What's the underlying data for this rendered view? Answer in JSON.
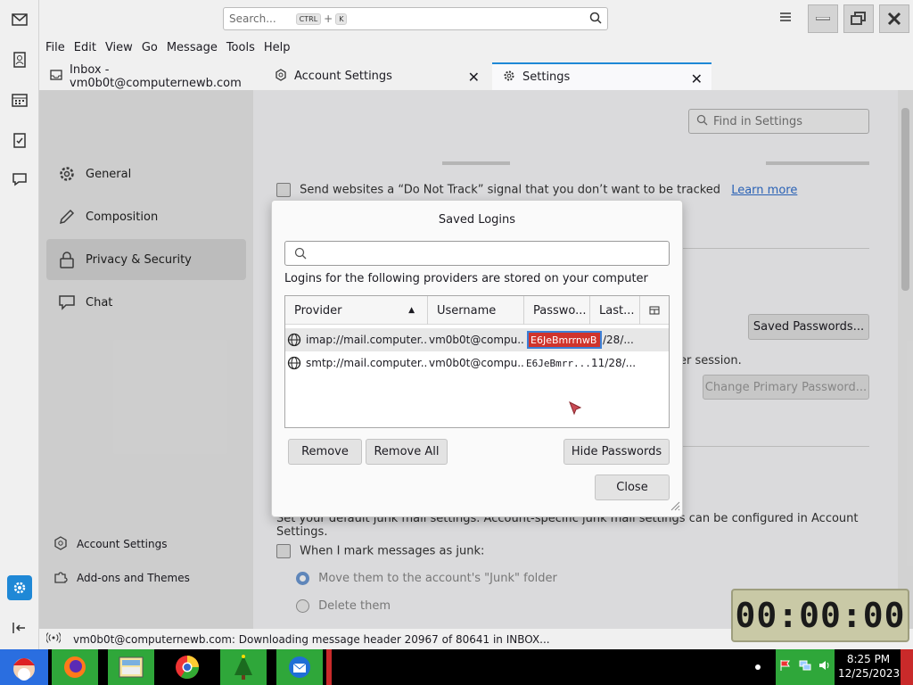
{
  "window": {
    "search_placeholder": "Search...",
    "kbd_ctrl": "CTRL",
    "kbd_plus": "+",
    "kbd_k": "K"
  },
  "menu": [
    "File",
    "Edit",
    "View",
    "Go",
    "Message",
    "Tools",
    "Help"
  ],
  "tabs": [
    {
      "label": "Inbox - vm0b0t@computernewb.com"
    },
    {
      "label": "Account Settings"
    },
    {
      "label": "Settings"
    }
  ],
  "sidebar": {
    "items": [
      {
        "label": "General"
      },
      {
        "label": "Composition"
      },
      {
        "label": "Privacy & Security"
      },
      {
        "label": "Chat"
      }
    ],
    "footer": [
      {
        "label": "Account Settings"
      },
      {
        "label": "Add-ons and Themes"
      }
    ]
  },
  "settings": {
    "find_placeholder": "Find in Settings",
    "dnt_text": "Send websites a “Do Not Track” signal that you don’t want to be tracked",
    "learn_more": "Learn more",
    "saved_passwords_btn": "Saved Passwords...",
    "session_text": "er session.",
    "change_primary_btn": "Change Primary Password...",
    "junk_desc": "Set your default junk mail settings. Account-specific junk mail settings can be configured in Account Settings.",
    "junk_mark": "When I mark messages as junk:",
    "junk_move": "Move them to the account's \"Junk\" folder",
    "junk_delete": "Delete them"
  },
  "dialog": {
    "title": "Saved Logins",
    "info": "Logins for the following providers are stored on your computer",
    "columns": [
      "Provider",
      "Username",
      "Passwo...",
      "Last..."
    ],
    "rows": [
      {
        "provider": "imap://mail.computer...",
        "username": "vm0b0t@compu...",
        "password": "E6JeBmrrnwB",
        "last": "/28/..."
      },
      {
        "provider": "smtp://mail.computer...",
        "username": "vm0b0t@compu...",
        "password": "E6JeBmrr...",
        "last": "11/28/..."
      }
    ],
    "remove": "Remove",
    "remove_all": "Remove All",
    "hide_passwords": "Hide Passwords",
    "close": "Close"
  },
  "status": {
    "text": "vm0b0t@computernewb.com: Downloading message header 20967 of 80641 in INBOX..."
  },
  "clock": {
    "display": "00:00:00"
  },
  "taskbar": {
    "time": "8:25 PM",
    "date": "12/25/2023"
  },
  "colors": {
    "accent": "#1f88d6",
    "selected_password_bg": "#d0342c",
    "link": "#2f6fcf"
  }
}
